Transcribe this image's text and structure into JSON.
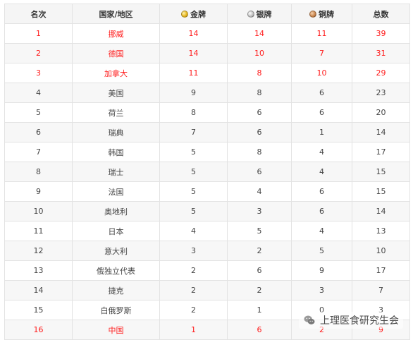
{
  "colors": {
    "highlight_text": "#ff1a1a",
    "gold": "#e8b923",
    "silver": "#b8b8b8",
    "bronze": "#cd8a52"
  },
  "table": {
    "headers": {
      "rank": "名次",
      "country": "国家/地区",
      "gold": "金牌",
      "silver": "银牌",
      "bronze": "铜牌",
      "total": "总数"
    },
    "medal_icons": {
      "gold": "gold-medal-icon",
      "silver": "silver-medal-icon",
      "bronze": "bronze-medal-icon"
    },
    "rows": [
      {
        "rank": "1",
        "country": "挪威",
        "gold": "14",
        "silver": "14",
        "bronze": "11",
        "total": "39",
        "highlight": true
      },
      {
        "rank": "2",
        "country": "德国",
        "gold": "14",
        "silver": "10",
        "bronze": "7",
        "total": "31",
        "highlight": true
      },
      {
        "rank": "3",
        "country": "加拿大",
        "gold": "11",
        "silver": "8",
        "bronze": "10",
        "total": "29",
        "highlight": true
      },
      {
        "rank": "4",
        "country": "美国",
        "gold": "9",
        "silver": "8",
        "bronze": "6",
        "total": "23",
        "highlight": false
      },
      {
        "rank": "5",
        "country": "荷兰",
        "gold": "8",
        "silver": "6",
        "bronze": "6",
        "total": "20",
        "highlight": false
      },
      {
        "rank": "6",
        "country": "瑞典",
        "gold": "7",
        "silver": "6",
        "bronze": "1",
        "total": "14",
        "highlight": false
      },
      {
        "rank": "7",
        "country": "韩国",
        "gold": "5",
        "silver": "8",
        "bronze": "4",
        "total": "17",
        "highlight": false
      },
      {
        "rank": "8",
        "country": "瑞士",
        "gold": "5",
        "silver": "6",
        "bronze": "4",
        "total": "15",
        "highlight": false
      },
      {
        "rank": "9",
        "country": "法国",
        "gold": "5",
        "silver": "4",
        "bronze": "6",
        "total": "15",
        "highlight": false
      },
      {
        "rank": "10",
        "country": "奥地利",
        "gold": "5",
        "silver": "3",
        "bronze": "6",
        "total": "14",
        "highlight": false
      },
      {
        "rank": "11",
        "country": "日本",
        "gold": "4",
        "silver": "5",
        "bronze": "4",
        "total": "13",
        "highlight": false
      },
      {
        "rank": "12",
        "country": "意大利",
        "gold": "3",
        "silver": "2",
        "bronze": "5",
        "total": "10",
        "highlight": false
      },
      {
        "rank": "13",
        "country": "俄独立代表",
        "gold": "2",
        "silver": "6",
        "bronze": "9",
        "total": "17",
        "highlight": false
      },
      {
        "rank": "14",
        "country": "捷克",
        "gold": "2",
        "silver": "2",
        "bronze": "3",
        "total": "7",
        "highlight": false
      },
      {
        "rank": "15",
        "country": "白俄罗斯",
        "gold": "2",
        "silver": "1",
        "bronze": "0",
        "total": "3",
        "highlight": false
      },
      {
        "rank": "16",
        "country": "中国",
        "gold": "1",
        "silver": "6",
        "bronze": "2",
        "total": "9",
        "highlight": true
      }
    ]
  },
  "watermark": {
    "icon": "wechat-icon",
    "text": "上理医食研究生会"
  }
}
